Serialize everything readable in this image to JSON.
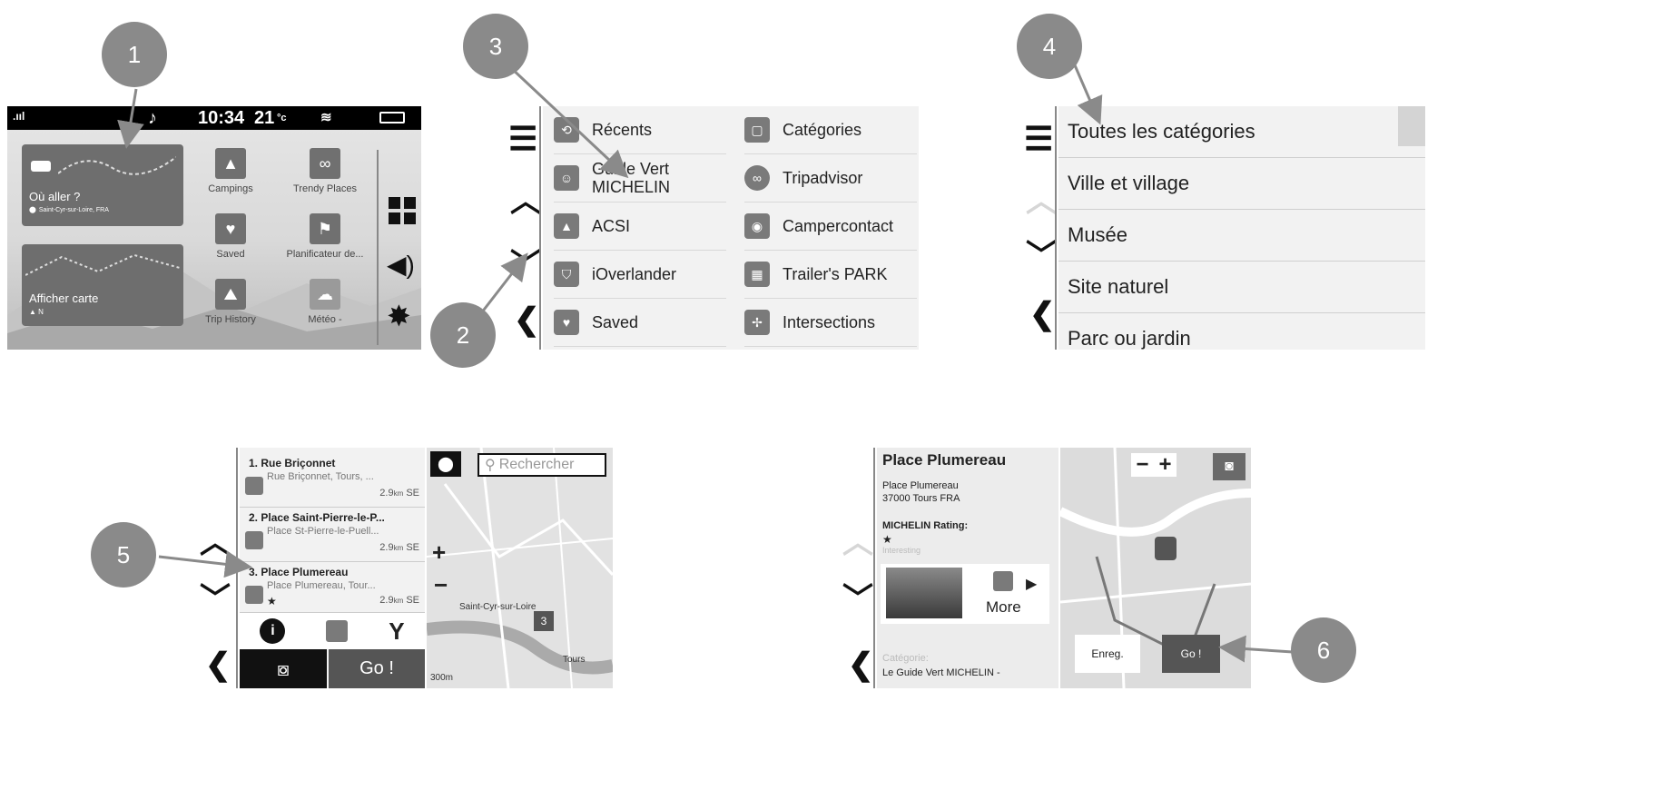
{
  "badges": [
    "1",
    "2",
    "3",
    "4",
    "5",
    "6"
  ],
  "panel1": {
    "status": {
      "time": "10:34",
      "temp": "21",
      "temp_unit": "°c"
    },
    "card1": {
      "title": "Où aller ?",
      "location": "Saint-Cyr-sur-Loire, FRA"
    },
    "card2": {
      "title": "Afficher carte",
      "sub": "N"
    },
    "tiles": [
      {
        "label": "Campings",
        "icon": "tent-icon"
      },
      {
        "label": "Trendy Places",
        "icon": "trendy-icon"
      },
      {
        "label": "Saved",
        "icon": "heart-icon"
      },
      {
        "label": "Planificateur de...",
        "icon": "planner-icon"
      },
      {
        "label": "Trip History",
        "icon": "history-icon"
      },
      {
        "label": "Météo -",
        "icon": "weather-icon"
      }
    ]
  },
  "panel2": {
    "items": [
      {
        "label": "Récents",
        "icon": "recent-icon"
      },
      {
        "label": "Catégories",
        "icon": "category-icon"
      },
      {
        "label": "Guide Vert MICHELIN",
        "icon": "michelin-icon"
      },
      {
        "label": "Tripadvisor",
        "icon": "tripadvisor-icon"
      },
      {
        "label": "ACSI",
        "icon": "acsi-icon"
      },
      {
        "label": "Campercontact",
        "icon": "campercontact-icon"
      },
      {
        "label": "iOverlander",
        "icon": "ioverlander-icon"
      },
      {
        "label": "Trailer's PARK",
        "icon": "trailers-park-icon"
      },
      {
        "label": "Saved",
        "icon": "heart-icon"
      },
      {
        "label": "Intersections",
        "icon": "intersection-icon"
      }
    ]
  },
  "panel4": {
    "rows": [
      "Toutes les catégories",
      "Ville et village",
      "Musée",
      "Site naturel",
      "Parc ou jardin"
    ]
  },
  "panel5": {
    "results": [
      {
        "num": "1.",
        "name": "Rue Briçonnet",
        "addr": "Rue Briçonnet, Tours, ...",
        "dist": "2.9",
        "unit": "km",
        "dir": "SE",
        "rating": ""
      },
      {
        "num": "2.",
        "name": "Place Saint-Pierre-le-P...",
        "addr": "Place St-Pierre-le-Puell...",
        "dist": "2.9",
        "unit": "km",
        "dir": "SE",
        "rating": ""
      },
      {
        "num": "3.",
        "name": "Place Plumereau",
        "addr": "Place Plumereau, Tour...",
        "dist": "2.9",
        "unit": "km",
        "dir": "SE",
        "rating": "★"
      }
    ],
    "search_placeholder": "Rechercher",
    "go_label": "Go !",
    "map_labels": [
      "Saint-Cyr-sur-Loire",
      "Tours"
    ],
    "scale": "300m"
  },
  "panel6": {
    "title": "Place Plumereau",
    "address_line1": "Place Plumereau",
    "address_line2": "37000 Tours FRA",
    "rating_label": "MICHELIN Rating:",
    "rating_value": "★",
    "rating_text": "Interesting",
    "more_label": "More",
    "category_label": "Catégorie:",
    "category_value": "Le Guide Vert MICHELIN -",
    "save_label": "Enreg.",
    "go_label": "Go !"
  }
}
